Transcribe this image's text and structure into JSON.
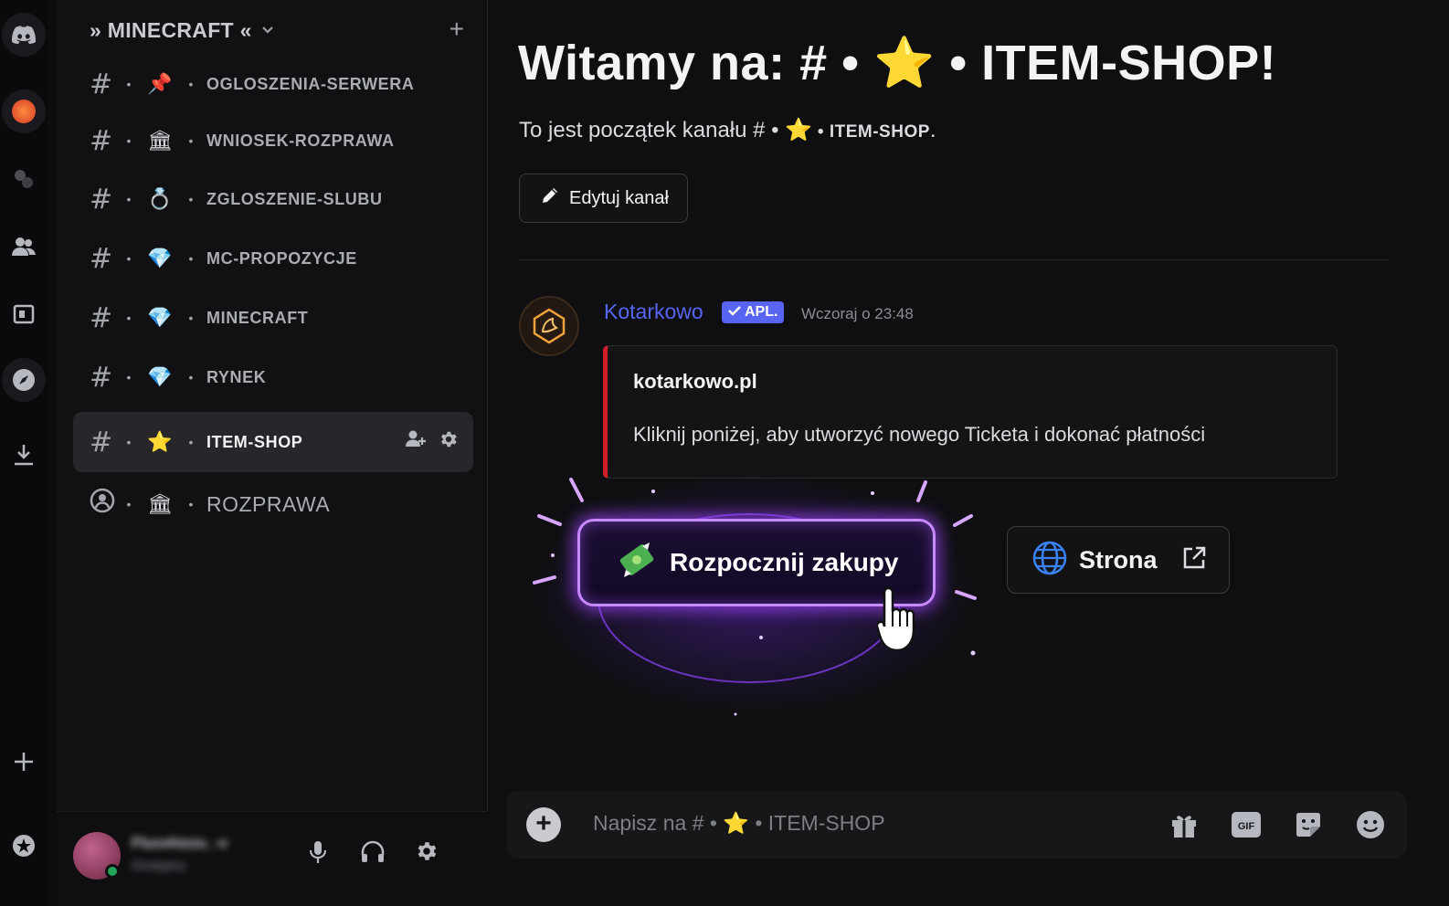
{
  "server": {
    "name": "» MINECRAFT «",
    "add_label": "+"
  },
  "channels": [
    {
      "emoji": "📌",
      "name": "OGLOSZENIA-SERWERA"
    },
    {
      "emoji": "🏛",
      "name": "WNIOSEK-ROZPRAWA"
    },
    {
      "emoji": "💍",
      "name": "ZGLOSZENIE-SLUBU"
    },
    {
      "emoji": "💎",
      "name": "MC-PROPOZYCJE"
    },
    {
      "emoji": "💎",
      "name": "MINECRAFT"
    },
    {
      "emoji": "💎",
      "name": "RYNEK"
    },
    {
      "emoji": "⭐",
      "name": "ITEM-SHOP",
      "active": true
    },
    {
      "emoji": "🏛",
      "name": "ROZPRAWA",
      "type": "voice"
    }
  ],
  "user": {
    "name": "Fluxxhizzu_-v",
    "status": "Dostępny"
  },
  "welcome": {
    "title": "Witamy na: # • ⭐ • ITEM-SHOP!",
    "subtitle_prefix": "To jest początek kanału # • ",
    "subtitle_emoji": "⭐",
    "subtitle_channel": " • ITEM-SHOP",
    "subtitle_end": ".",
    "edit_button": "Edytuj kanał"
  },
  "message": {
    "author": "Kotarkowo",
    "tag": "APL.",
    "timestamp": "Wczoraj o 23:48",
    "embed": {
      "title": "kotarkowo.pl",
      "description": "Kliknij poniżej, aby utworzyć nowego Ticketa i dokonać płatności"
    },
    "buttons": {
      "primary": "Rozpocznij zakupy",
      "secondary": "Strona"
    }
  },
  "composer": {
    "placeholder": "Napisz na # • ⭐ • ITEM-SHOP"
  },
  "colors": {
    "accent": "#5865f2",
    "embed_bar": "#d21f2e",
    "glow": "#a855f7",
    "online": "#23a55a"
  }
}
